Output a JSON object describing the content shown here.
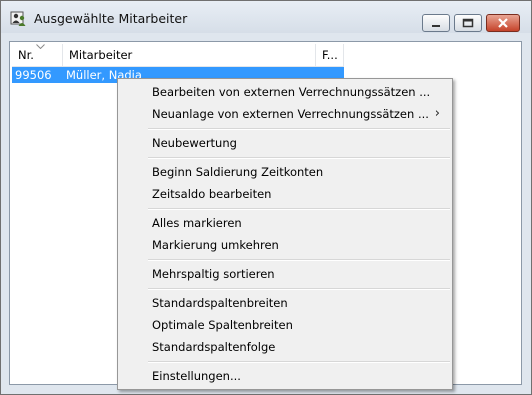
{
  "window": {
    "title": "Ausgewählte Mitarbeiter"
  },
  "table": {
    "columns": [
      "Nr.",
      "Mitarbeiter",
      "F..."
    ],
    "rows": [
      {
        "nr": "99506",
        "name": "Müller, Nadja"
      }
    ],
    "selection_color": "#3399ff"
  },
  "context_menu": {
    "items": [
      {
        "label": "Bearbeiten von externen Verrechnungssätzen ...",
        "submenu": false
      },
      {
        "label": "Neuanlage von externen Verrechnungssätzen ...",
        "submenu": true,
        "submenu_glyph": "›"
      },
      {
        "label": "Neubewertung",
        "submenu": false
      },
      {
        "label": "Beginn Saldierung Zeitkonten",
        "submenu": false
      },
      {
        "label": "Zeitsaldo bearbeiten",
        "submenu": false
      },
      {
        "label": "Alles markieren",
        "submenu": false
      },
      {
        "label": "Markierung umkehren",
        "submenu": false
      },
      {
        "label": "Mehrspaltig sortieren",
        "submenu": false
      },
      {
        "label": "Standardspaltenbreiten",
        "submenu": false
      },
      {
        "label": "Optimale Spaltenbreiten",
        "submenu": false
      },
      {
        "label": "Standardspaltenfolge",
        "submenu": false
      },
      {
        "label": "Einstellungen...",
        "submenu": false
      }
    ]
  },
  "icons": {
    "app": "people-icon",
    "minimize": "minimize-icon",
    "maximize": "maximize-icon",
    "close": "close-icon",
    "sort": "sort-indicator-icon",
    "submenu": "chevron-right-icon"
  }
}
